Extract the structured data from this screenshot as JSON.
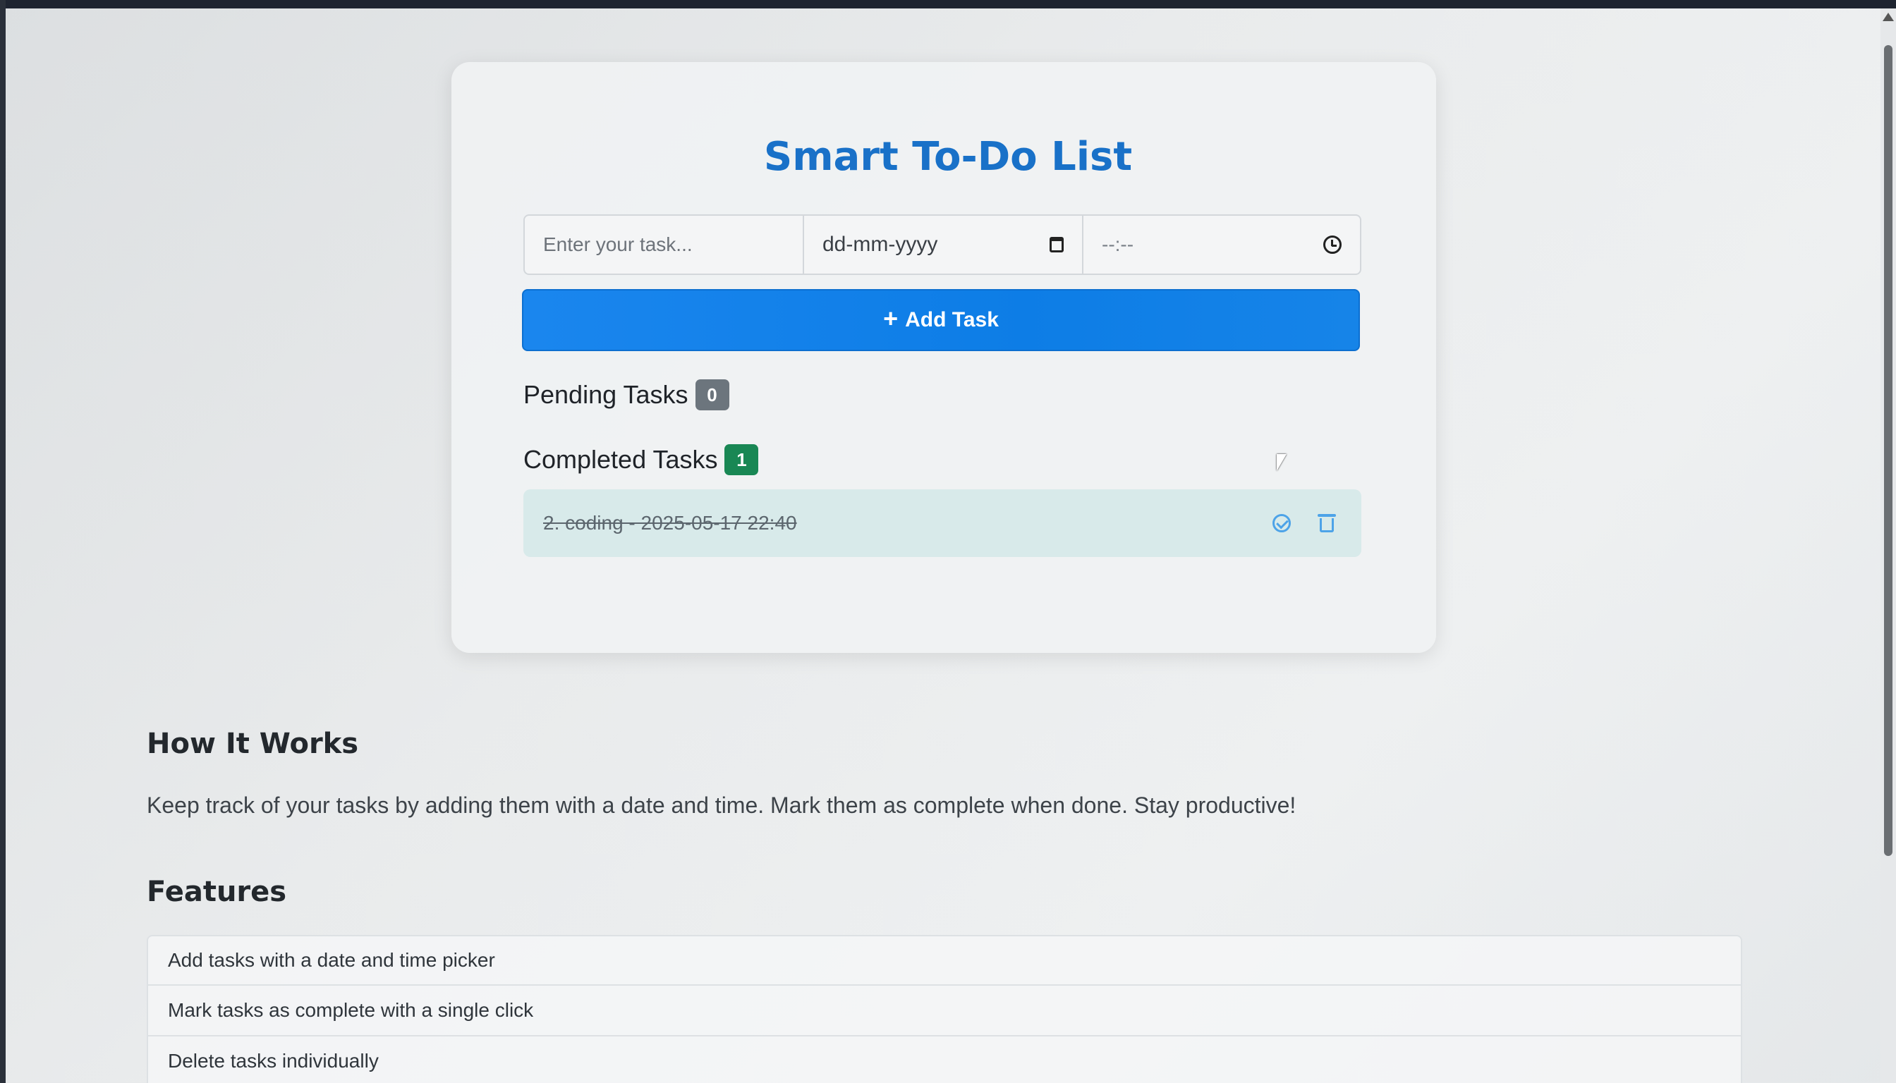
{
  "app": {
    "title": "Smart To-Do List"
  },
  "form": {
    "task_placeholder": "Enter your task...",
    "date_value": "dd-mm-yyyy",
    "time_value": "--:--",
    "add_button_label": "Add Task",
    "add_button_icon": "plus-icon"
  },
  "pending": {
    "heading": "Pending Tasks",
    "count": "0",
    "badge_color": "#6c757d"
  },
  "completed": {
    "heading": "Completed Tasks",
    "count": "1",
    "badge_color": "#198754",
    "items": [
      {
        "text": "2. coding - 2025-05-17 22:40"
      }
    ]
  },
  "how_it_works": {
    "heading": "How It Works",
    "text": "Keep track of your tasks by adding them with a date and time. Mark them as complete when done. Stay productive!"
  },
  "features": {
    "heading": "Features",
    "items": [
      "Add tasks with a date and time picker",
      "Mark tasks as complete with a single click",
      "Delete tasks individually"
    ]
  },
  "colors": {
    "accent": "#1971c8",
    "button": "#0d7de6",
    "completed_item_bg": "#d8eaea"
  }
}
